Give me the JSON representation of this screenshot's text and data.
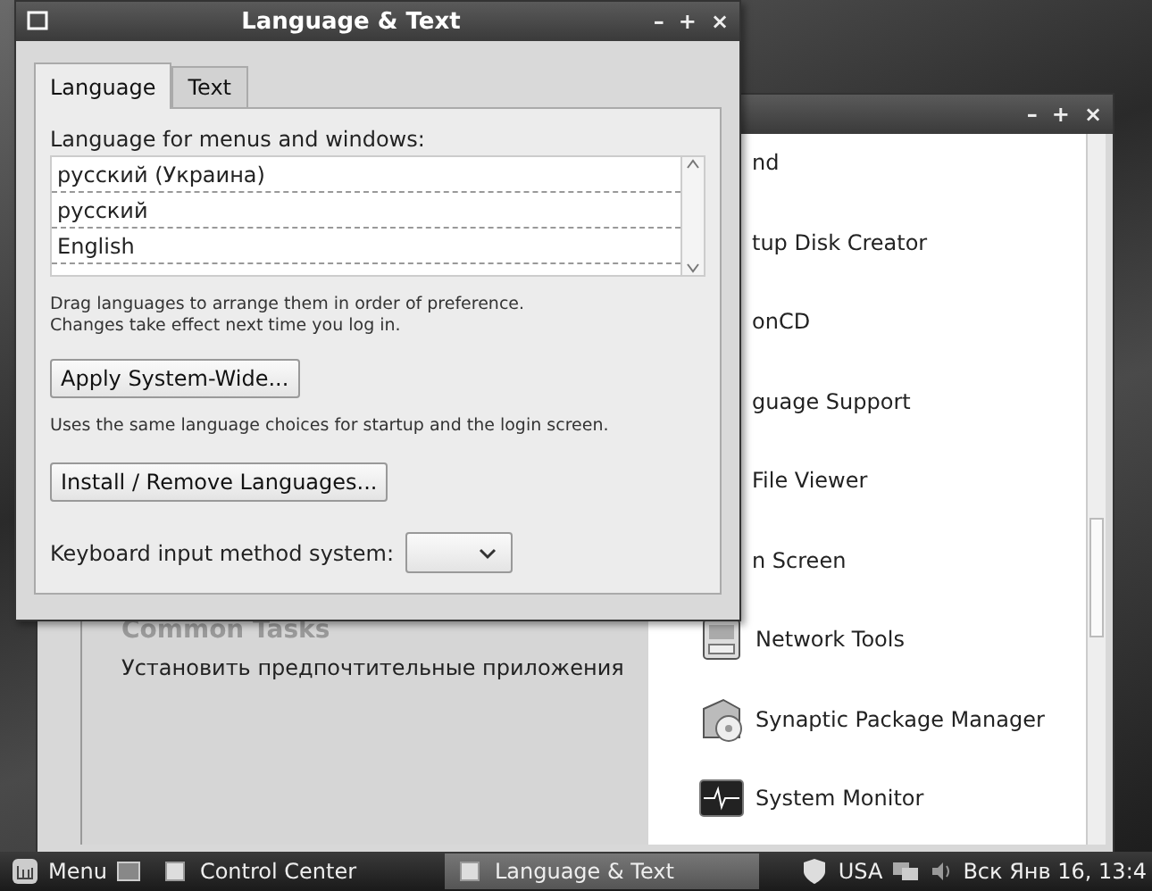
{
  "back_window": {
    "controls": [
      "–",
      "+",
      "×"
    ],
    "common_tasks": {
      "heading": "Common Tasks",
      "items": [
        "Установить предпочтительные приложения"
      ]
    },
    "apps": [
      {
        "label": "nd",
        "kind": "covered"
      },
      {
        "label": "tup Disk Creator",
        "kind": "covered"
      },
      {
        "label": "onCD",
        "kind": "covered"
      },
      {
        "label": "guage Support",
        "kind": "covered"
      },
      {
        "label": "File Viewer",
        "kind": "covered"
      },
      {
        "label": "n Screen",
        "kind": "covered"
      },
      {
        "label": "Network Tools",
        "kind": "network"
      },
      {
        "label": "Synaptic Package Manager",
        "kind": "package"
      },
      {
        "label": "System Monitor",
        "kind": "monitor"
      }
    ]
  },
  "dialog": {
    "title": "Language & Text",
    "controls": [
      "–",
      "+",
      "×"
    ],
    "tabs": [
      {
        "label": "Language",
        "selected": true
      },
      {
        "label": "Text",
        "selected": false
      }
    ],
    "list_label": "Language for menus and windows:",
    "languages": [
      "русский (Украина)",
      "русский",
      "English"
    ],
    "hints": [
      "Drag languages to arrange them in order of preference.",
      "Changes take effect next time you log in."
    ],
    "apply_button": "Apply System-Wide...",
    "apply_note": "Uses the same language choices for startup and the login screen.",
    "install_button": "Install / Remove Languages...",
    "input_method_label": "Keyboard input method system:"
  },
  "taskbar": {
    "menu": "Menu",
    "tasks": [
      {
        "label": "Control Center",
        "selected": false
      },
      {
        "label": "Language & Text",
        "selected": true
      }
    ],
    "layout": "USA",
    "clock": "Вск Янв 16, 13:4"
  }
}
